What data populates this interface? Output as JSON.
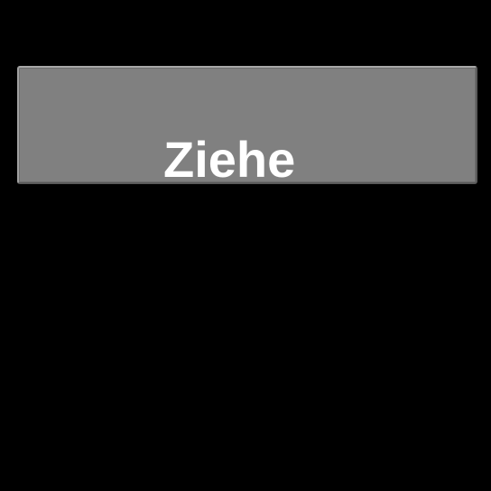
{
  "button": {
    "label": "Ziehe"
  },
  "colors": {
    "background": "#000000",
    "button_fill": "#808080",
    "label_text": "#ffffff"
  }
}
